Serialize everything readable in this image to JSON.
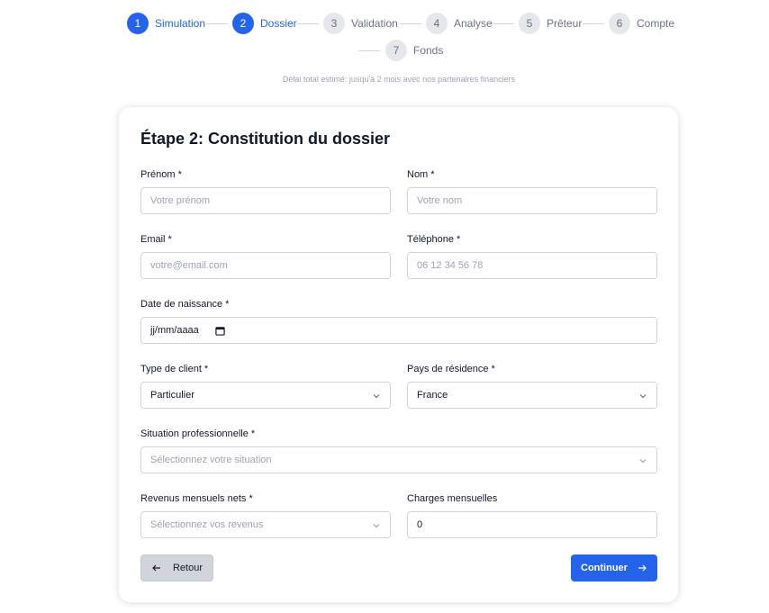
{
  "steps": [
    {
      "num": "1",
      "label": "Simulation"
    },
    {
      "num": "2",
      "label": "Dossier"
    },
    {
      "num": "3",
      "label": "Validation"
    },
    {
      "num": "4",
      "label": "Analyse"
    },
    {
      "num": "5",
      "label": "Prêteur"
    },
    {
      "num": "6",
      "label": "Compte"
    },
    {
      "num": "7",
      "label": "Fonds"
    }
  ],
  "estimate": "Délai total estimé: jusqu'à 2 mois avec nos partenaires financiers",
  "form": {
    "title": "Étape 2: Constitution du dossier",
    "prenom": {
      "label": "Prénom *",
      "placeholder": "Votre prénom"
    },
    "nom": {
      "label": "Nom *",
      "placeholder": "Votre nom"
    },
    "email": {
      "label": "Email *",
      "placeholder": "votre@email.com"
    },
    "telephone": {
      "label": "Téléphone *",
      "placeholder": "06 12 34 56 78"
    },
    "naissance": {
      "label": "Date de naissance *",
      "value": "jj/mm/aaaa"
    },
    "type_client": {
      "label": "Type de client *",
      "value": "Particulier"
    },
    "pays": {
      "label": "Pays de résidence *",
      "value": "France"
    },
    "situation": {
      "label": "Situation professionnelle *",
      "placeholder": "Sélectionnez votre situation"
    },
    "revenus": {
      "label": "Revenus mensuels nets *",
      "placeholder": "Sélectionnez vos revenus"
    },
    "charges": {
      "label": "Charges mensuelles",
      "value": "0"
    }
  },
  "buttons": {
    "back": "Retour",
    "next": "Continuer"
  },
  "colors": {
    "accent": "#2563eb",
    "inactive": "#e5e7eb",
    "back_button": "#d1d5db"
  }
}
